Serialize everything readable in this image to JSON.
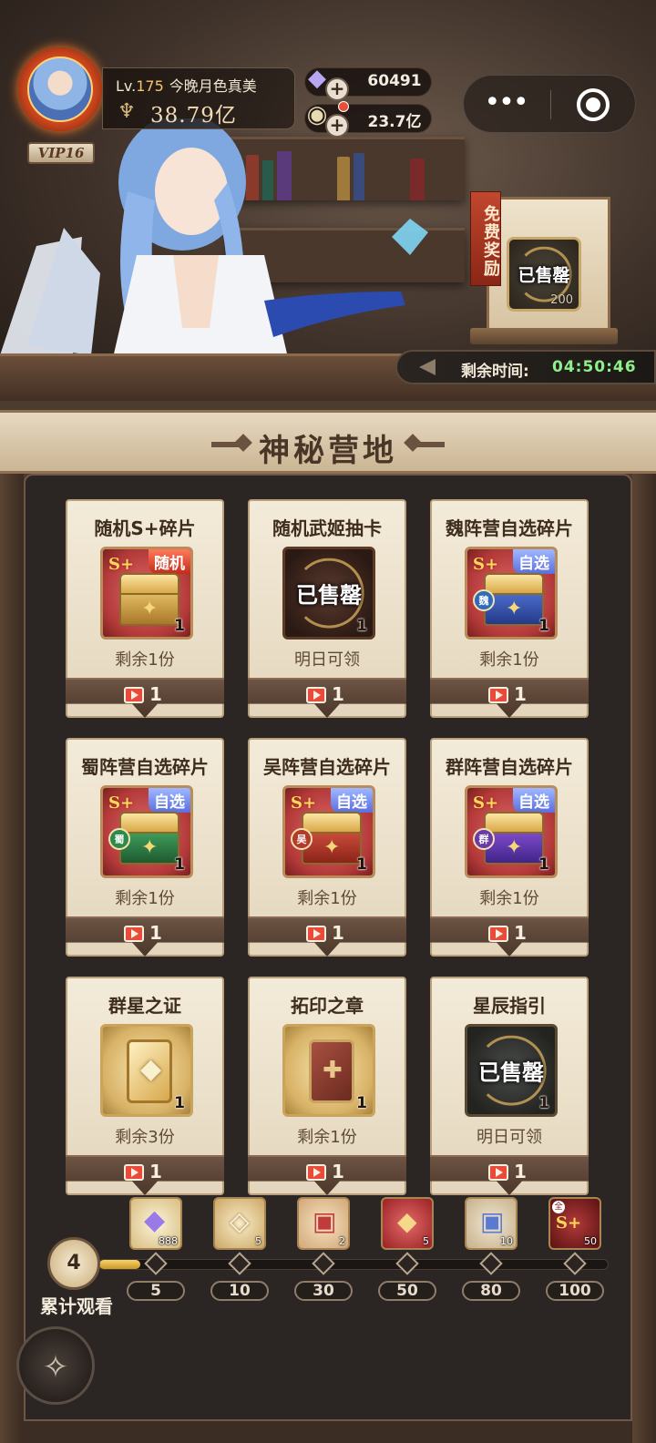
{
  "player": {
    "level_prefix": "Lv.",
    "level": "175",
    "name": "今晚月色真美",
    "power": "38.79亿",
    "vip": "VIP16"
  },
  "resources": {
    "gems": "60491",
    "coins": "23.7亿"
  },
  "free_reward": {
    "tag": "免费奖励",
    "stamp": "已售罄",
    "count": "200"
  },
  "timer": {
    "label": "剩余时间:",
    "value": "04:50:46"
  },
  "board": {
    "title": "神秘营地"
  },
  "cards": [
    {
      "title": "随机S+碎片",
      "ribbon": "随机",
      "qty": "1",
      "sub": "剩余1份",
      "cost": "1"
    },
    {
      "title": "随机武姬抽卡",
      "stamp": "已售罄",
      "qty": "1",
      "sub": "明日可领",
      "cost": "1"
    },
    {
      "title": "魏阵营自选碎片",
      "ribbon": "自选",
      "faction": "魏",
      "qty": "1",
      "sub": "剩余1份",
      "cost": "1"
    },
    {
      "title": "蜀阵营自选碎片",
      "ribbon": "自选",
      "faction": "蜀",
      "qty": "1",
      "sub": "剩余1份",
      "cost": "1"
    },
    {
      "title": "吴阵营自选碎片",
      "ribbon": "自选",
      "faction": "吴",
      "qty": "1",
      "sub": "剩余1份",
      "cost": "1"
    },
    {
      "title": "群阵营自选碎片",
      "ribbon": "自选",
      "faction": "群",
      "qty": "1",
      "sub": "剩余1份",
      "cost": "1"
    },
    {
      "title": "群星之证",
      "qty": "1",
      "sub": "剩余3份",
      "cost": "1"
    },
    {
      "title": "拓印之章",
      "qty": "1",
      "sub": "剩余1份",
      "cost": "1"
    },
    {
      "title": "星辰指引",
      "stamp": "已售罄",
      "qty": "1",
      "sub": "明日可领",
      "cost": "1"
    }
  ],
  "progress": {
    "watched": "4",
    "label": "累计观看",
    "fill_fraction": 0.08,
    "milestones": [
      {
        "value": "5",
        "reward_qty": "888",
        "icon": "diamond-icon"
      },
      {
        "value": "10",
        "reward_qty": "5",
        "icon": "crystal-card-icon"
      },
      {
        "value": "30",
        "reward_qty": "2",
        "icon": "chest-icon"
      },
      {
        "value": "50",
        "reward_qty": "5",
        "icon": "red-card-icon"
      },
      {
        "value": "80",
        "reward_qty": "10",
        "icon": "blue-chest-icon"
      },
      {
        "value": "100",
        "reward_qty": "50",
        "icon": "splus-fragment-icon",
        "corner": "全"
      }
    ]
  },
  "colors": {
    "timer_green": "#8ef08a",
    "gold": "#f5c56a",
    "video_red": "#e94a3a"
  }
}
